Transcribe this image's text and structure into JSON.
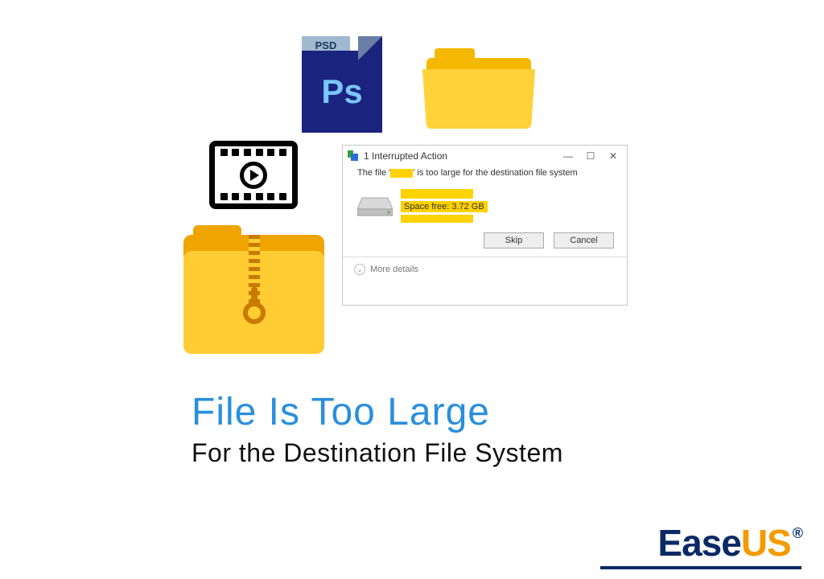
{
  "psd": {
    "tab": "PSD",
    "label": "Ps"
  },
  "dialog": {
    "title": "1 Interrupted Action",
    "message_prefix": "The file '",
    "message_suffix": "' is too large for the destination file system",
    "space_free": "Space free: 3.72 GB",
    "skip": "Skip",
    "cancel": "Cancel",
    "more": "More details",
    "minimize": "—",
    "maximize": "☐",
    "close": "✕"
  },
  "headline": {
    "line1": "File Is Too Large",
    "line2": "For the Destination File System"
  },
  "logo": {
    "part1": "Ease",
    "part2": "US",
    "reg": "®"
  }
}
